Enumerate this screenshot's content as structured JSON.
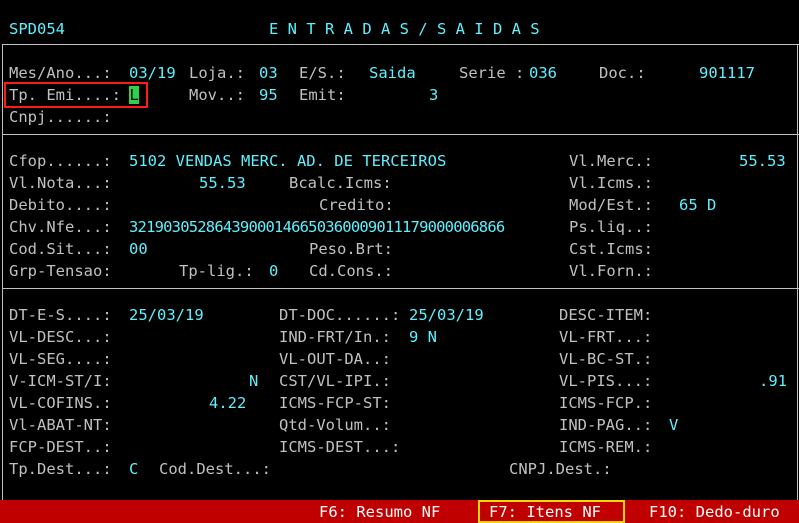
{
  "header": {
    "program": "SPD054",
    "title": "E N T R A D A S / S A I D A S"
  },
  "sec1": {
    "mes_ano_label": "Mes/Ano...:",
    "mes_ano": "03/19",
    "loja_label": "Loja.:",
    "loja": "03",
    "es_label": "E/S.:",
    "es": "Saida",
    "serie_label": "Serie :",
    "serie": "036",
    "doc_label": "Doc.:",
    "doc": "901117",
    "tp_emi_label": "Tp. Emi....:",
    "tp_emi": "L",
    "mov_label": "Mov..:",
    "mov": "95",
    "emit_label": "Emit:",
    "emit": "3",
    "cnpj_label": "Cnpj......:"
  },
  "sec2": {
    "cfop_label": "Cfop......:",
    "cfop": "5102 VENDAS MERC. AD. DE TERCEIROS",
    "vl_merc_label": "Vl.Merc.:",
    "vl_merc": "55.53",
    "vl_nota_label": "Vl.Nota...:",
    "vl_nota": "55.53",
    "bcalc_label": "Bcalc.Icms:",
    "vl_icms_label": "Vl.Icms.:",
    "debito_label": "Debito....:",
    "credito_label": "Credito:",
    "mod_est_label": "Mod/Est.:",
    "mod_est": "65 D",
    "chv_label": "Chv.Nfe...:",
    "chv": "32190305286439000146650360009011179000006866",
    "ps_liq_label": "Ps.liq..:",
    "cod_sit_label": "Cod.Sit...:",
    "cod_sit": "00",
    "peso_label": "Peso.Brt:",
    "cst_icms_label": "Cst.Icms:",
    "grp_label": "Grp-Tensao:",
    "tp_lig_label": "Tp-lig.:",
    "tp_lig": "0",
    "cd_cons_label": "Cd.Cons.:",
    "vl_forn_label": "Vl.Forn.:"
  },
  "sec3": {
    "dt_es_label": "DT-E-S....:",
    "dt_es": "25/03/19",
    "dt_doc_label": "DT-DOC......:",
    "dt_doc": "25/03/19",
    "desc_item_label": "DESC-ITEM:",
    "vl_desc_label": "VL-DESC...:",
    "ind_frt_label": "IND-FRT/In.:",
    "ind_frt": "9 N",
    "vl_frt_label": "VL-FRT...:",
    "vl_seg_label": "VL-SEG....:",
    "vl_out_label": "VL-OUT-DA..:",
    "vl_bc_st_label": "VL-BC-ST.:",
    "v_icm_label": "V-ICM-ST/I:",
    "v_icm": "N",
    "cst_ipi_label": "CST/VL-IPI.:",
    "vl_pis_label": "VL-PIS...:",
    "vl_pis": ".91",
    "vl_cofins_label": "VL-COFINS.:",
    "vl_cofins": "4.22",
    "icms_fcp_st_label": "ICMS-FCP-ST:",
    "icms_fcp_label": "ICMS-FCP.:",
    "vl_abat_label": "Vl-ABAT-NT:",
    "qtd_label": "Qtd-Volum..:",
    "ind_pag_label": "IND-PAG..:",
    "ind_pag": "V",
    "fcp_dest_label": "FCP-DEST..:",
    "icms_dest_label": "ICMS-DEST...:",
    "icms_rem_label": "ICMS-REM.:",
    "tp_dest_label": "Tp.Dest...:",
    "tp_dest": "C",
    "cod_dest_label": "Cod.Dest...:",
    "cnpj_dest_label": "CNPJ.Dest.:"
  },
  "footer": {
    "f6": "F6: Resumo NF",
    "f7": "F7: Itens NF",
    "f10": "F10: Dedo-duro"
  }
}
